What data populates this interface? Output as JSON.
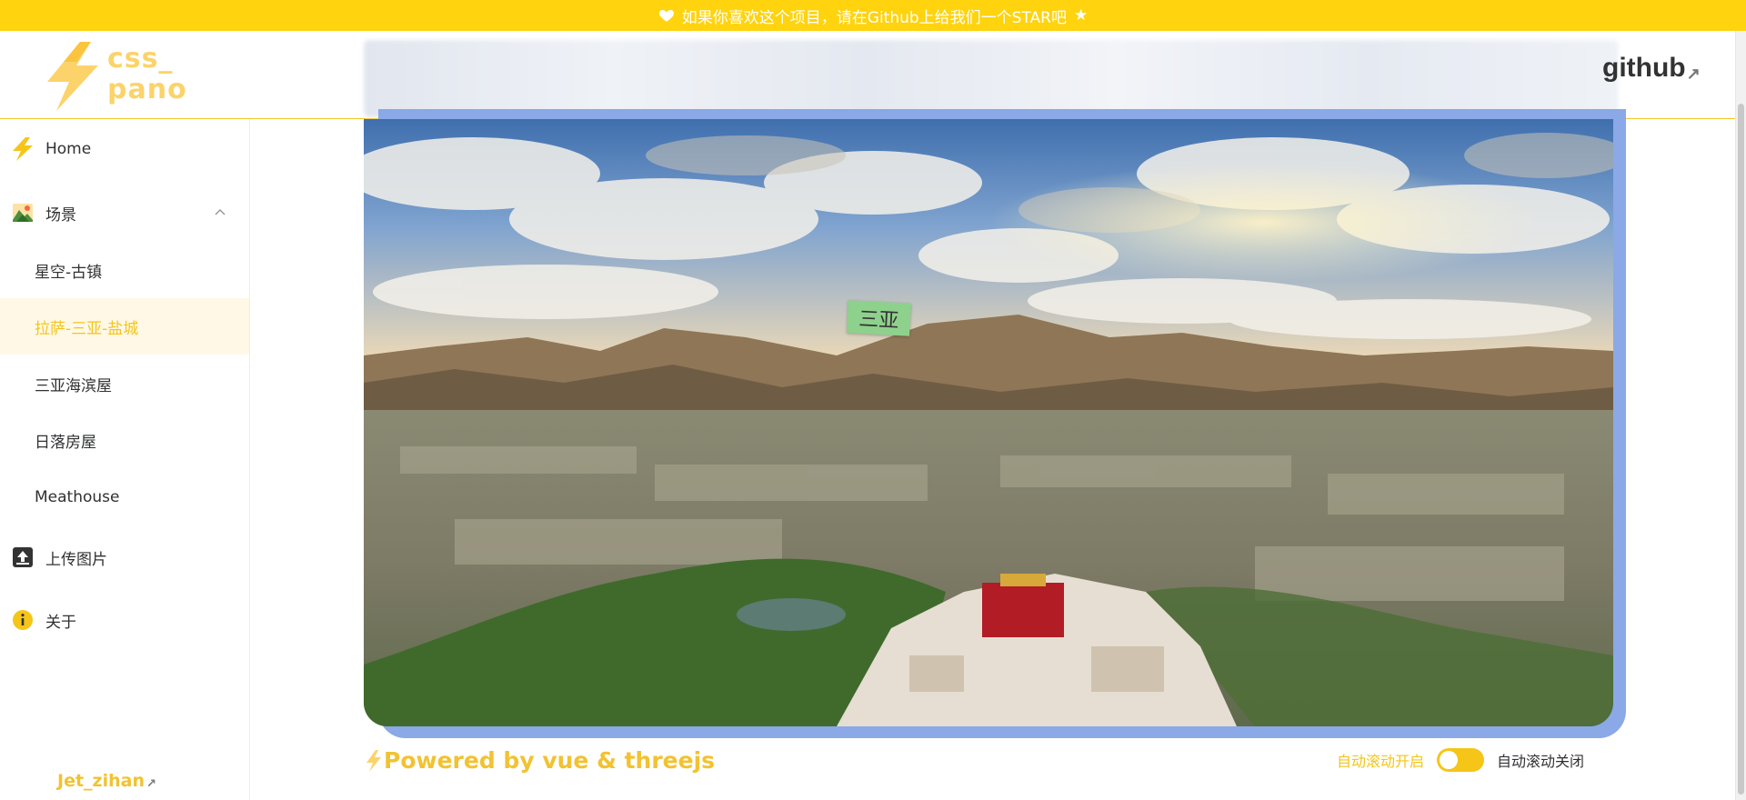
{
  "banner": {
    "text": "如果你喜欢这个项目，请在Github上给我们一个STAR吧",
    "star": "★",
    "color": "#ffd30e"
  },
  "header": {
    "logo_line1": "css_",
    "logo_line2": "pano",
    "github_label": "github",
    "github_arrow": "↗"
  },
  "sidebar": {
    "home_label": "Home",
    "scenes_label": "场景",
    "scenes": [
      {
        "label": "星空-古镇",
        "active": false
      },
      {
        "label": "拉萨-三亚-盐城",
        "active": true
      },
      {
        "label": "三亚海滨屋",
        "active": false
      },
      {
        "label": "日落房屋",
        "active": false
      },
      {
        "label": "Meathouse",
        "active": false
      }
    ],
    "upload_label": "上传图片",
    "about_label": "关于",
    "author": "Jet_zihan",
    "author_arrow": "↗"
  },
  "pano": {
    "hotspot_label": "三亚"
  },
  "footer": {
    "powered_by": "Powered by vue & threejs",
    "autoscroll_on": "自动滚动开启",
    "autoscroll_off": "自动滚动关闭",
    "autoscroll_enabled": true
  },
  "colors": {
    "accent": "#f5c518",
    "active_bg": "#fff8e6",
    "pano_shadow": "#8aa9e6",
    "hotspot_bg": "#8ed18c"
  }
}
